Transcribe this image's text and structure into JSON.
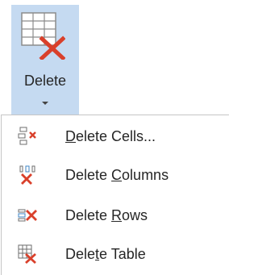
{
  "delete_button": {
    "label": "Delete",
    "icon": "delete-table-icon"
  },
  "menu": {
    "items": [
      {
        "label": "Delete Cells...",
        "access_key": "D",
        "icon": "delete-cells-icon"
      },
      {
        "label": "Delete Columns",
        "access_key": "C",
        "icon": "delete-columns-icon"
      },
      {
        "label": "Delete Rows",
        "access_key": "R",
        "icon": "delete-rows-icon"
      },
      {
        "label": "Delete Table",
        "access_key": "t",
        "icon": "delete-table-icon"
      }
    ]
  },
  "colors": {
    "pressed_background": "#c5daf1",
    "delete_red": "#d9402b",
    "text": "#262626",
    "menu_border": "#c6c6c6"
  }
}
